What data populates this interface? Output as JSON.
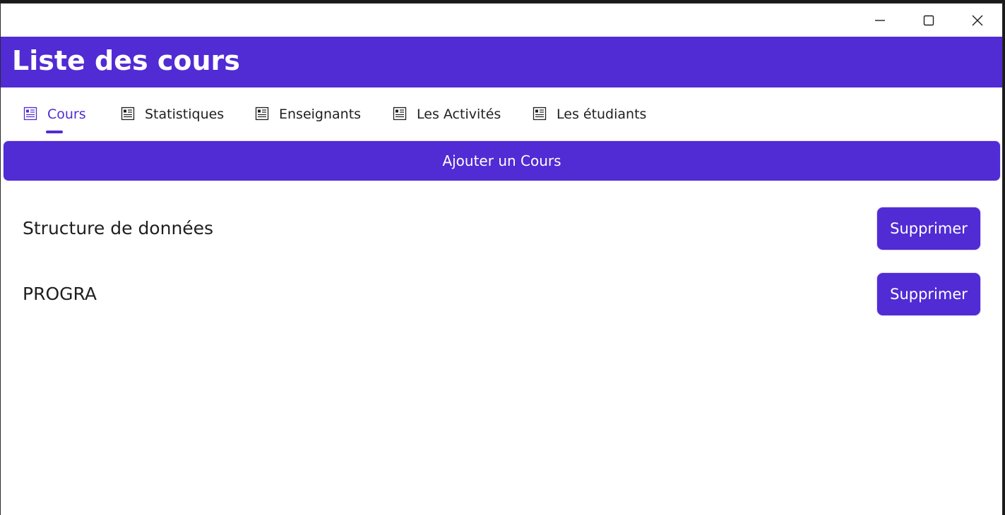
{
  "window": {
    "controls": {
      "minimize": "minimize-icon",
      "maximize": "maximize-icon",
      "close": "close-icon"
    }
  },
  "header": {
    "title": "Liste des cours",
    "background": "#512bd4"
  },
  "tabs": [
    {
      "label": "Cours",
      "icon": "list-icon",
      "active": true
    },
    {
      "label": "Statistiques",
      "icon": "list-icon",
      "active": false
    },
    {
      "label": "Enseignants",
      "icon": "list-icon",
      "active": false
    },
    {
      "label": "Les Activités",
      "icon": "list-icon",
      "active": false
    },
    {
      "label": "Les étudiants",
      "icon": "list-icon",
      "active": false
    }
  ],
  "actions": {
    "add_course_label": "Ajouter un Cours"
  },
  "courses": [
    {
      "name": "Structure de données",
      "delete_label": "Supprimer"
    },
    {
      "name": "PROGRA",
      "delete_label": "Supprimer"
    }
  ],
  "colors": {
    "accent": "#512bd4",
    "text": "#1f1f1f"
  }
}
